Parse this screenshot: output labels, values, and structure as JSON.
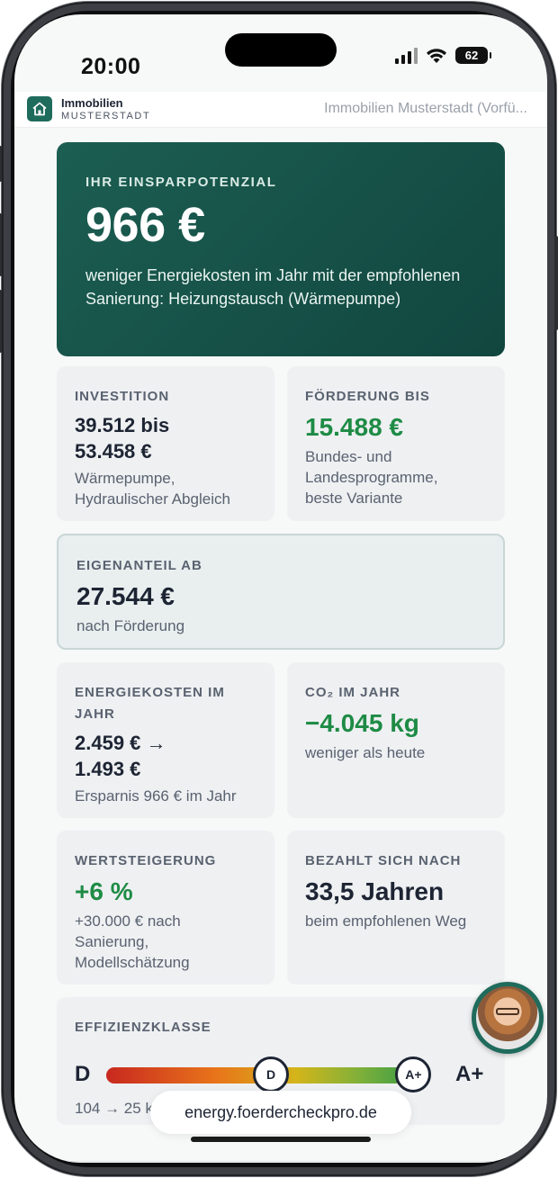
{
  "status_bar": {
    "time": "20:00",
    "battery": "62"
  },
  "header": {
    "brand_line1": "Immobilien",
    "brand_line2": "MUSTERSTADT",
    "tab_title": "Immobilien Musterstadt (Vorfü..."
  },
  "hero": {
    "kicker": "IHR EINSPARPOTENZIAL",
    "value": "966 €",
    "description": "weniger Energiekosten im Jahr mit der empfohlenen Sanierung: Heizungstausch (Wärmepumpe)"
  },
  "cards": {
    "investment": {
      "kicker": "INVESTITION",
      "value": "39.512 bis 53.458 €",
      "sub": "Wärmepumpe, Hydraulischer Abgleich"
    },
    "funding": {
      "kicker": "FÖRDERUNG BIS",
      "value": "15.488 €",
      "sub": "Bundes- und Landesprogramme, beste Variante"
    },
    "own_share": {
      "kicker": "EIGENANTEIL AB",
      "value": "27.544 €",
      "sub": "nach Förderung"
    },
    "energy_costs": {
      "kicker": "ENERGIEKOSTEN IM JAHR",
      "value": "2.459 € → 1.493 €",
      "sub": "Ersparnis 966 € im Jahr"
    },
    "co2": {
      "kicker": "CO₂ IM JAHR",
      "value": "−4.045 kg",
      "sub": "weniger als heute"
    },
    "value_increase": {
      "kicker": "WERTSTEIGERUNG",
      "value": "+6 %",
      "sub": "+30.000 € nach Sanierung, Modellschätzung"
    },
    "payback": {
      "kicker": "BEZAHLT SICH NACH",
      "value": "33,5 Jahren",
      "sub": "beim empfohlenen Weg"
    }
  },
  "efficiency": {
    "kicker": "EFFIZIENZKLASSE",
    "current_class": "D",
    "target_class": "A+",
    "marker_current": "D",
    "marker_target": "A+",
    "current_position": 0.52,
    "target_position": 0.97,
    "sub": "104 → 25 kWh je m² und Jahr"
  },
  "browser": {
    "url": "energy.foerdercheckpro.de"
  },
  "colors": {
    "hero": "#1c5e52",
    "accent_green": "#1e8b45",
    "card": "#eef0f2"
  }
}
